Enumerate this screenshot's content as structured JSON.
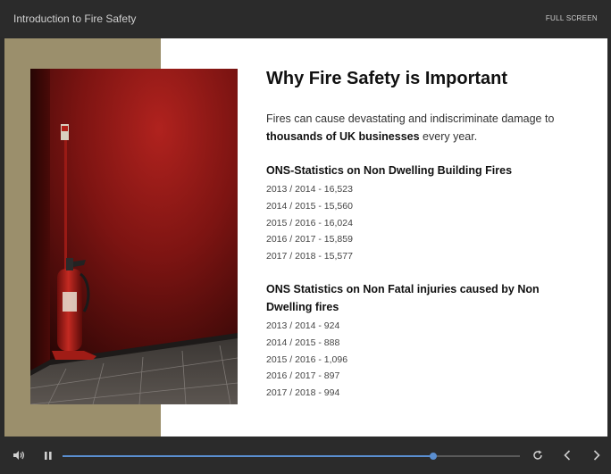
{
  "header": {
    "course_title": "Introduction to Fire Safety",
    "fullscreen_label": "FULL SCREEN"
  },
  "slide": {
    "heading": "Why Fire Safety is Important",
    "intro": {
      "text_before": "Fires can cause devastating and indiscriminate damage to ",
      "text_bold": "thousands of UK businesses",
      "text_after": " every year."
    },
    "sections": [
      {
        "title": "ONS-Statistics on Non Dwelling Building Fires",
        "items": [
          "2013 / 2014 - 16,523",
          "2014 / 2015 - 15,560",
          "2015 / 2016 - 16,024",
          "2016 / 2017 - 15,859",
          "2017 / 2018 - 15,577"
        ]
      },
      {
        "title": "ONS Statistics on Non Fatal injuries caused by Non Dwelling fires",
        "items": [
          "2013 / 2014 - 924",
          "2014 / 2015 - 888",
          "2015 / 2016 - 1,096",
          "2016 / 2017 - 897",
          "2017 / 2018 - 994"
        ]
      }
    ],
    "image": {
      "icon": "fire-extinguisher-photo"
    }
  },
  "player": {
    "progress_fraction": 0.81,
    "icons": {
      "volume": "volume-icon",
      "pause": "pause-icon",
      "replay": "replay-icon",
      "prev": "chevron-left-icon",
      "next": "chevron-right-icon"
    },
    "colors": {
      "accent": "#5a8ed0",
      "bar_bg": "#2b2b2b",
      "panel": "#9b8f6c"
    }
  }
}
